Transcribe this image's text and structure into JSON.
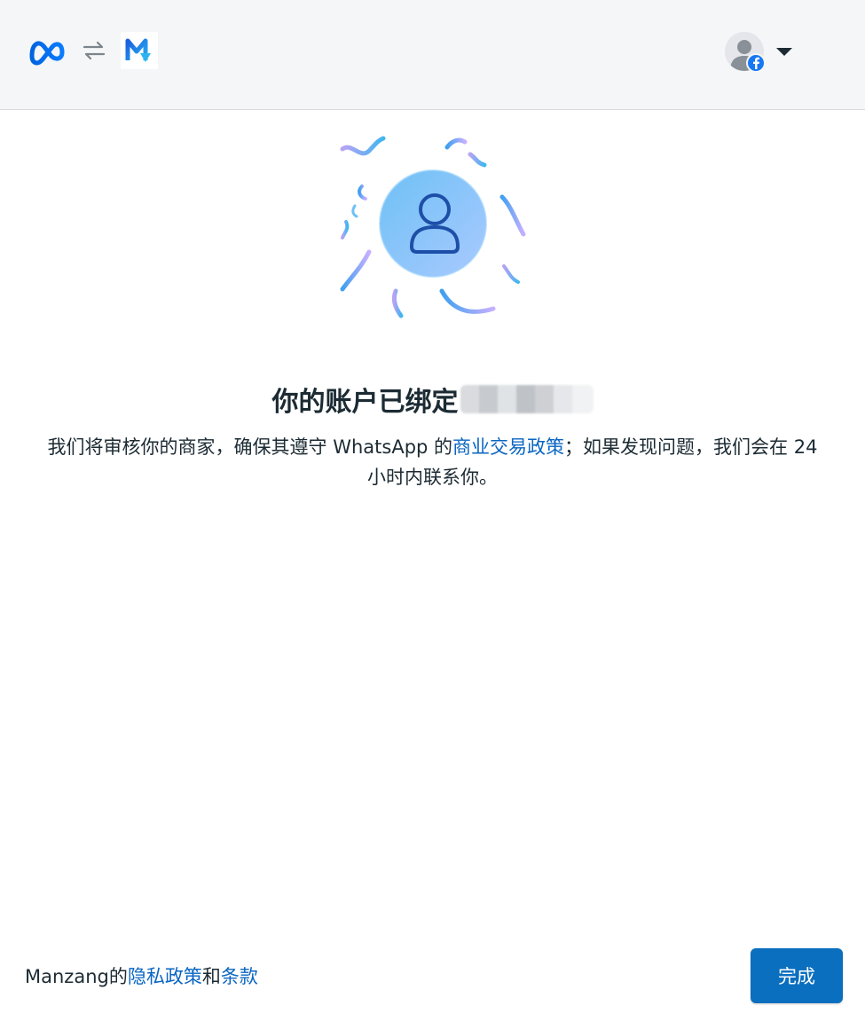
{
  "header": {
    "meta_logo_icon": "meta-infinity-icon",
    "link_icon": "swap-arrows-icon",
    "app_logo_icon": "manzang-m-logo",
    "account_avatar_icon": "profile-avatar",
    "facebook_badge_icon": "facebook-icon",
    "account_menu_icon": "caret-down-icon"
  },
  "main": {
    "illustration_icon": "person-confetti-illustration",
    "title": "你的账户已绑定",
    "description_before": "我们将审核你的商家，确保其遵守 WhatsApp 的",
    "description_link": "商业交易政策",
    "description_after": "；如果发现问题，我们会在 24 小时内联系你。"
  },
  "footer": {
    "company": "Manzang",
    "possessive": "的",
    "privacy_link": "隐私政策",
    "conjunction": "和",
    "terms_link": "条款",
    "done_label": "完成"
  },
  "colors": {
    "link": "#0a66c2",
    "primary_button": "#0b6fbf",
    "header_bg": "#f5f6f7",
    "meta_blue": "#0668e1",
    "facebook_blue": "#1877f2"
  }
}
